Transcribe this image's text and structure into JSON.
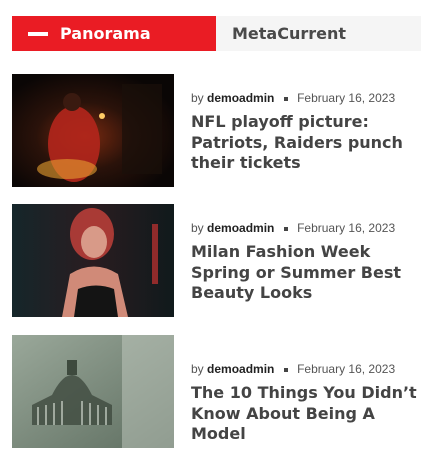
{
  "tabs": [
    {
      "label": "Panorama",
      "active": true
    },
    {
      "label": "MetaCurrent",
      "active": false
    }
  ],
  "accent_color": "#ea1c24",
  "posts": [
    {
      "by": "by",
      "author": "demoadmin",
      "date": "February 16, 2023",
      "title": "NFL playoff picture: Patriots, Raiders punch their tickets"
    },
    {
      "by": "by",
      "author": "demoadmin",
      "date": "February 16, 2023",
      "title": "Milan Fashion Week Spring or Summer Best Beauty Looks"
    },
    {
      "by": "by",
      "author": "demoadmin",
      "date": "February 16, 2023",
      "title": "The 10 Things You Didn’t Know About Being A Model"
    }
  ]
}
